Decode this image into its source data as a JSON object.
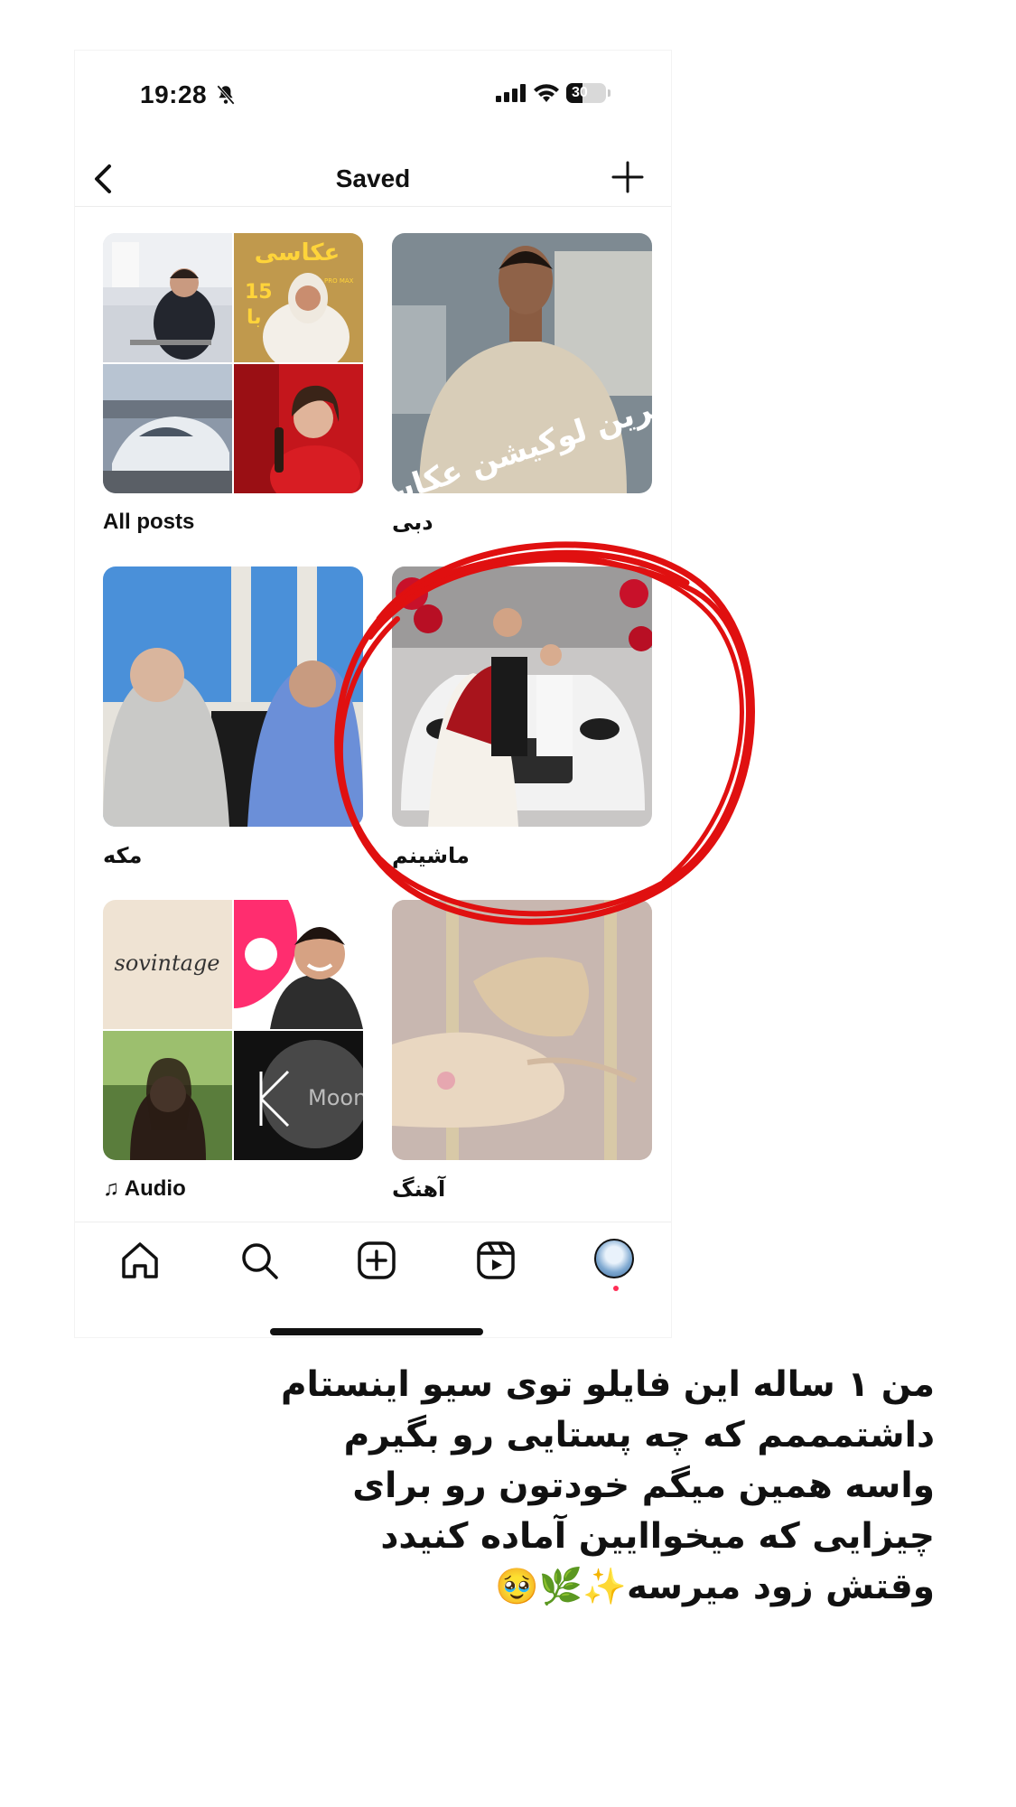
{
  "status_bar": {
    "time": "19:28",
    "battery_level": "30",
    "icons": [
      "bell-slash-icon",
      "cellular-signal-icon",
      "wifi-icon",
      "battery-icon"
    ]
  },
  "header": {
    "title": "Saved",
    "back_icon": "chevron-left-icon",
    "add_icon": "plus-icon"
  },
  "collections": [
    {
      "label": "All posts",
      "type": "grid-4"
    },
    {
      "label": "دبی",
      "type": "single",
      "overlay_text": "بهترین لوکیشن عکاسی"
    },
    {
      "label": "مکه",
      "type": "single"
    },
    {
      "label": "ماشینم",
      "type": "single",
      "highlighted": true
    },
    {
      "label": "♫ Audio",
      "type": "grid-4",
      "thumb_text": [
        "sovintage",
        "Moon"
      ]
    },
    {
      "label": "آهنگ",
      "type": "single"
    }
  ],
  "all_posts_thumb_text": {
    "title": "عکاسی",
    "line2": "با",
    "num": "15",
    "small": "PRO MAX"
  },
  "bottom_nav": {
    "items": [
      "home-icon",
      "search-icon",
      "create-icon",
      "reels-icon",
      "profile-avatar"
    ],
    "active": "profile-avatar"
  },
  "caption": "من ۱ ساله این فایلو توی سیو اینستام\nداشتمممم که چه پستایی رو بگیرم\nواسه همین میگم خودتون رو برای\nچیزایی که میخواایین آماده کنیدد\nوقتش زود میرسه✨🌿🥹",
  "colors": {
    "scribble": "#e01010",
    "accent": "#ff2d55"
  }
}
